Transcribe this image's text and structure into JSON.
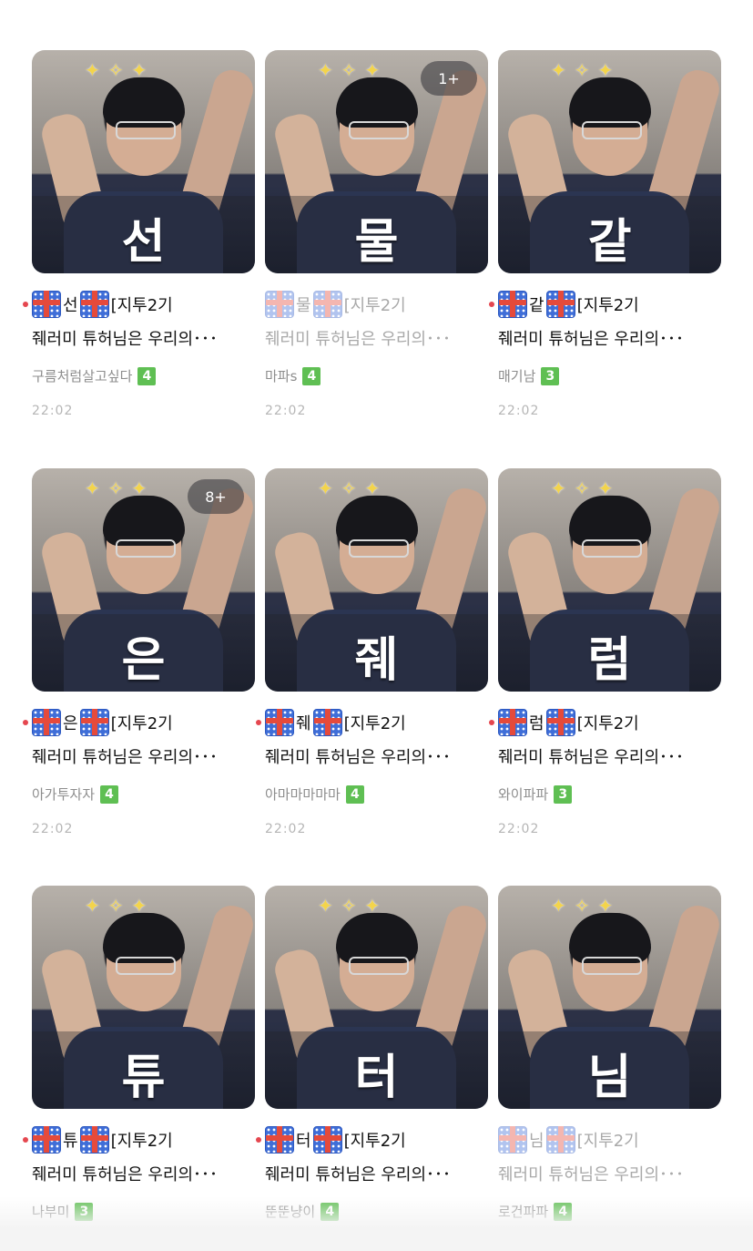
{
  "posts": [
    {
      "big_char": "선",
      "badge": "",
      "unread": true,
      "faded": false,
      "title_char": "선",
      "title_suffix": "[지투2기",
      "desc": "줴러미 튜허님은 우리의･･･",
      "author": "구름처럼살고싶다",
      "level": "4",
      "time": "22:02"
    },
    {
      "big_char": "물",
      "badge": "1+",
      "unread": false,
      "faded": true,
      "title_char": "물",
      "title_suffix": "[지투2기",
      "desc": "줴러미 튜허님은 우리의･･･",
      "author": "마파s",
      "level": "4",
      "time": "22:02"
    },
    {
      "big_char": "같",
      "badge": "",
      "unread": true,
      "faded": false,
      "title_char": "같",
      "title_suffix": "[지투2기",
      "desc": "줴러미 튜허님은 우리의･･･",
      "author": "매기남",
      "level": "3",
      "time": "22:02"
    },
    {
      "big_char": "은",
      "badge": "8+",
      "unread": true,
      "faded": false,
      "title_char": "은",
      "title_suffix": "[지투2기",
      "desc": "줴러미 튜허님은 우리의･･･",
      "author": "아가투자자",
      "level": "4",
      "time": "22:02"
    },
    {
      "big_char": "줴",
      "badge": "",
      "unread": true,
      "faded": false,
      "title_char": "줴",
      "title_suffix": "[지투2기",
      "desc": "줴러미 튜허님은 우리의･･･",
      "author": "아마마마마마",
      "level": "4",
      "time": "22:02"
    },
    {
      "big_char": "럼",
      "badge": "",
      "unread": true,
      "faded": false,
      "title_char": "럼",
      "title_suffix": "[지투2기",
      "desc": "줴러미 튜허님은 우리의･･･",
      "author": "와이파파",
      "level": "3",
      "time": "22:02"
    },
    {
      "big_char": "튜",
      "badge": "",
      "unread": true,
      "faded": false,
      "title_char": "튜",
      "title_suffix": "[지투2기",
      "desc": "줴러미 튜허님은 우리의･･･",
      "author": "나부미",
      "level": "3",
      "time": ""
    },
    {
      "big_char": "터",
      "badge": "",
      "unread": true,
      "faded": false,
      "title_char": "터",
      "title_suffix": "[지투2기",
      "desc": "줴러미 튜허님은 우리의･･･",
      "author": "뚠뚠냥이",
      "level": "4",
      "time": ""
    },
    {
      "big_char": "님",
      "badge": "",
      "unread": false,
      "faded": true,
      "title_char": "님",
      "title_suffix": "[지투2기",
      "desc": "줴러미 튜허님은 우리의･･･",
      "author": "로건파파",
      "level": "4",
      "time": ""
    }
  ],
  "icons": {
    "gift": "gift-icon",
    "unread_dot": "unread-dot-icon"
  },
  "colors": {
    "unread_dot": "#e5474f",
    "level_badge": "#5fbf53",
    "gift_blue": "#3f6ed8",
    "gift_ribbon": "#e54a3b"
  }
}
